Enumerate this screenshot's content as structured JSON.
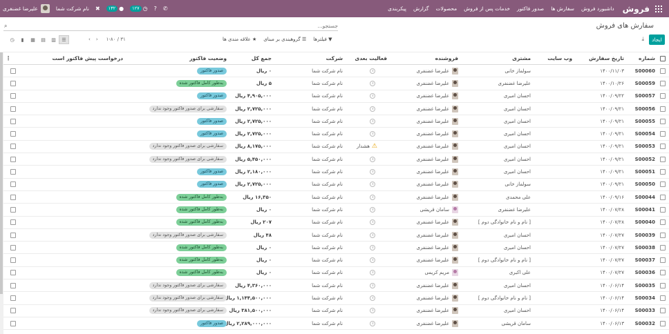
{
  "navbar": {
    "brand": "فروش",
    "menu": [
      "داشبورد فروش",
      "سفارش ها",
      "صدور فاکتور",
      "خدمات پس از فروش",
      "محصولات",
      "گزارش",
      "پیکربندی"
    ],
    "company": "نام شرکت شما",
    "user": "علیرضا غضنفری",
    "activity_count": "۱۳۲",
    "message_count": "۱۲۷"
  },
  "control": {
    "breadcrumb": "سفارش های فروش",
    "search_placeholder": "جستجو...",
    "create_label": "ایجاد",
    "filters_label": "فیلترها",
    "groupby_label": "گروهبندی بر مبنای",
    "favorites_label": "علاقه مندی ها",
    "pager": "۱-۸۰ / ۳۱"
  },
  "columns": {
    "number": "شماره",
    "date": "تاریخ سفارش",
    "website": "وب سایت",
    "customer": "مشتری",
    "salesperson": "فروشنده",
    "next_activity": "فعالیت بعدی",
    "company": "شرکت",
    "total": "جمع کل",
    "invoice_status": "وضعیت فاکتور",
    "pre_invoice": "درخواست پیش فاکتور است"
  },
  "rows": [
    {
      "num": "S00060",
      "date": "۱۴۰۰/۱۱/۰۳",
      "customer": "سولماز خانی",
      "sales": "علیرضا غضنفری",
      "act": "",
      "company": "نام شرکت شما",
      "total": "۰ ریال",
      "status": "صدور فاکتور",
      "status_color": "blue"
    },
    {
      "num": "S00059",
      "date": "۱۴۰۰/۱۰/۲۶",
      "customer": "علیرضا غضنفری",
      "sales": "علیرضا غضنفری",
      "act": "",
      "company": "نام شرکت شما",
      "total": "۵ ریال",
      "status": "به‌طور کامل فاکتور شده",
      "status_color": "green"
    },
    {
      "num": "S00057",
      "date": "۱۴۰۰/۰۹/۲۲",
      "customer": "احسان امیری",
      "sales": "علیرضا غضنفری",
      "act": "",
      "company": "نام شرکت شما",
      "total": "۴,۹۰۵,۰۰۰ ریال",
      "status": "صدور فاکتور",
      "status_color": "blue"
    },
    {
      "num": "S00056",
      "date": "۱۴۰۰/۰۹/۲۱",
      "customer": "احسان امیری",
      "sales": "علیرضا غضنفری",
      "act": "",
      "company": "نام شرکت شما",
      "total": "۲,۷۲۵,۰۰۰ ریال",
      "status": "سفارشی برای صدور فاکتور وجود ندارد",
      "status_color": "grey"
    },
    {
      "num": "S00055",
      "date": "۱۴۰۰/۰۹/۲۱",
      "customer": "احسان امیری",
      "sales": "علیرضا غضنفری",
      "act": "",
      "company": "نام شرکت شما",
      "total": "۲,۷۲۵,۰۰۰ ریال",
      "status": "صدور فاکتور",
      "status_color": "blue"
    },
    {
      "num": "S00054",
      "date": "۱۴۰۰/۰۹/۲۱",
      "customer": "احسان امیری",
      "sales": "علیرضا غضنفری",
      "act": "",
      "company": "نام شرکت شما",
      "total": "۲,۷۲۵,۰۰۰ ریال",
      "status": "صدور فاکتور",
      "status_color": "blue"
    },
    {
      "num": "S00053",
      "date": "۱۴۰۰/۰۹/۲۱",
      "customer": "احسان امیری",
      "sales": "علیرضا غضنفری",
      "act": "هشدار",
      "company": "نام شرکت شما",
      "total": "۸,۱۷۵,۰۰۰ ریال",
      "status": "سفارشی برای صدور فاکتور وجود ندارد",
      "status_color": "grey"
    },
    {
      "num": "S00052",
      "date": "۱۴۰۰/۰۹/۲۱",
      "customer": "احسان امیری",
      "sales": "علیرضا غضنفری",
      "act": "",
      "company": "نام شرکت شما",
      "total": "۵,۴۵۰,۰۰۰ ریال",
      "status": "سفارشی برای صدور فاکتور وجود ندارد",
      "status_color": "grey"
    },
    {
      "num": "S00051",
      "date": "۱۴۰۰/۰۹/۲۱",
      "customer": "احسان امیری",
      "sales": "علیرضا غضنفری",
      "act": "",
      "company": "نام شرکت شما",
      "total": "۲,۱۸۰,۰۰۰ ریال",
      "status": "صدور فاکتور",
      "status_color": "blue"
    },
    {
      "num": "S00050",
      "date": "۱۴۰۰/۰۹/۲۱",
      "customer": "سولماز خانی",
      "sales": "علیرضا غضنفری",
      "act": "",
      "company": "نام شرکت شما",
      "total": "۲,۷۲۵,۰۰۰ ریال",
      "status": "صدور فاکتور",
      "status_color": "blue"
    },
    {
      "num": "S00044",
      "date": "۱۴۰۰/۰۹/۱۶",
      "customer": "علی محمدی",
      "sales": "علیرضا غضنفری",
      "act": "",
      "company": "نام شرکت شما",
      "total": "۱۶,۳۵۰ ریال",
      "status": "به‌طور کامل فاکتور شده",
      "status_color": "green"
    },
    {
      "num": "S00041",
      "date": "۱۴۰۰/۰۷/۲۸",
      "customer": "علیرضا غضنفری",
      "sales": "سامان قریشی",
      "act": "",
      "company": "نام شرکت شما",
      "total": "۰ ریال",
      "status": "به‌طور کامل فاکتور شده",
      "status_color": "green",
      "alt": true
    },
    {
      "num": "S00040",
      "date": "۱۴۰۰/۰۷/۲۸",
      "customer": "[ نام و نام خانوادگی دوم ]",
      "sales": "علیرضا غضنفری",
      "act": "",
      "company": "نام شرکت شما",
      "total": "۲۰۷ ریال",
      "status": "به‌طور کامل فاکتور شده",
      "status_color": "green"
    },
    {
      "num": "S00039",
      "date": "۱۴۰۰/۰۷/۲۷",
      "customer": "احسان امیری",
      "sales": "علیرضا غضنفری",
      "act": "",
      "company": "نام شرکت شما",
      "total": "۴۸ ریال",
      "status": "سفارشی برای صدور فاکتور وجود ندارد",
      "status_color": "grey"
    },
    {
      "num": "S00038",
      "date": "۱۴۰۰/۰۷/۲۷",
      "customer": "احسان امیری",
      "sales": "علیرضا غضنفری",
      "act": "",
      "company": "نام شرکت شما",
      "total": "۰ ریال",
      "status": "به‌طور کامل فاکتور شده",
      "status_color": "green"
    },
    {
      "num": "S00037",
      "date": "۱۴۰۰/۰۷/۲۷",
      "customer": "[ نام و نام خانوادگی دوم ]",
      "sales": "علیرضا غضنفری",
      "act": "",
      "company": "نام شرکت شما",
      "total": "۰ ریال",
      "status": "به‌طور کامل فاکتور شده",
      "status_color": "green"
    },
    {
      "num": "S00036",
      "date": "۱۴۰۰/۰۷/۲۷",
      "customer": "علی اکبری",
      "sales": "مریم کریمی",
      "act": "",
      "company": "نام شرکت شما",
      "total": "۰ ریال",
      "status": "به‌طور کامل فاکتور شده",
      "status_color": "green",
      "alt": true
    },
    {
      "num": "S00035",
      "date": "۱۴۰۰/۰۶/۱۴",
      "customer": "احسان امیری",
      "sales": "علیرضا غضنفری",
      "act": "",
      "company": "نام شرکت شما",
      "total": "۴,۳۶۰,۰۰۰ ریال",
      "status": "سفارشی برای صدور فاکتور وجود ندارد",
      "status_color": "grey"
    },
    {
      "num": "S00034",
      "date": "۱۴۰۰/۰۶/۱۴",
      "customer": "[ نام و نام خانوادگی دوم ]",
      "sales": "علیرضا غضنفری",
      "act": "",
      "company": "نام شرکت شما",
      "total": "۱,۱۴۴,۵۰۰,۰۰۰ ریال",
      "status": "سفارشی برای صدور فاکتور وجود ندارد",
      "status_color": "grey"
    },
    {
      "num": "S00033",
      "date": "۱۴۰۰/۰۶/۱۴",
      "customer": "احسان امیری",
      "sales": "علیرضا غضنفری",
      "act": "",
      "company": "نام شرکت شما",
      "total": "۳۸۱,۵۰۰,۰۰۰ ریال",
      "status": "سفارشی برای صدور فاکتور وجود ندارد",
      "status_color": "grey"
    },
    {
      "num": "S00032",
      "date": "۱۴۰۰/۰۶/۱۳",
      "customer": "سامان قریشی",
      "sales": "علیرضا غضنفری",
      "act": "",
      "company": "نام شرکت شما",
      "total": "۲,۲۸۹,۰۰۰,۰۰۰ ریال",
      "status": "صدور فاکتور",
      "status_color": "blue"
    }
  ]
}
